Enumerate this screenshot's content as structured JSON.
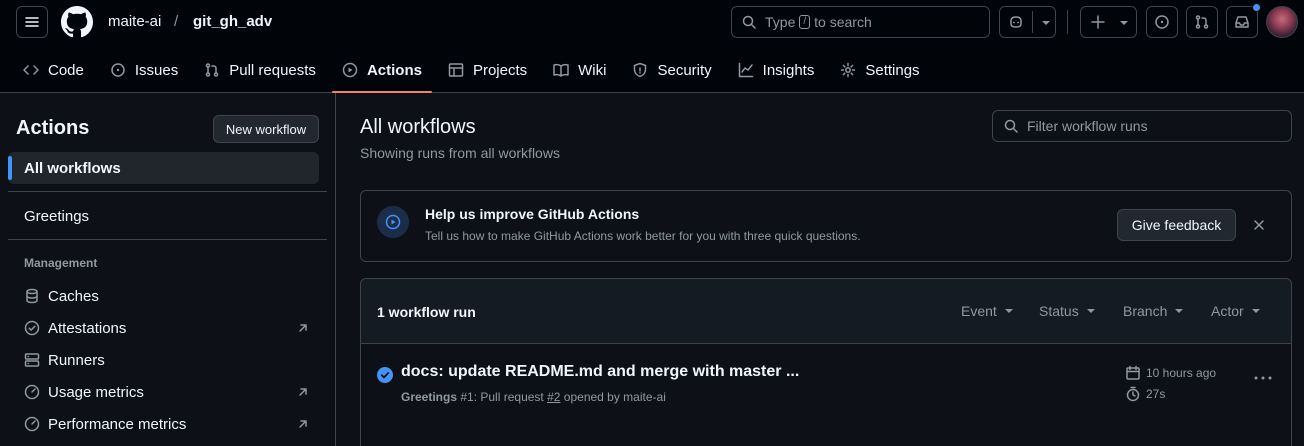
{
  "header": {
    "owner": "maite-ai",
    "separator": "/",
    "repo": "git_gh_adv",
    "search": {
      "prefix": "Type",
      "key": "/",
      "suffix": "to search"
    }
  },
  "tabs": [
    {
      "label": "Code",
      "icon": "code-icon"
    },
    {
      "label": "Issues",
      "icon": "issue-icon"
    },
    {
      "label": "Pull requests",
      "icon": "pull-request-icon"
    },
    {
      "label": "Actions",
      "icon": "play-icon",
      "selected": true
    },
    {
      "label": "Projects",
      "icon": "table-icon"
    },
    {
      "label": "Wiki",
      "icon": "book-icon"
    },
    {
      "label": "Security",
      "icon": "shield-icon"
    },
    {
      "label": "Insights",
      "icon": "graph-icon"
    },
    {
      "label": "Settings",
      "icon": "gear-icon"
    }
  ],
  "sidebar": {
    "title": "Actions",
    "new_workflow": "New workflow",
    "all_workflows": "All workflows",
    "greetings": "Greetings",
    "management_label": "Management",
    "management": [
      {
        "label": "Caches",
        "icon": "database-icon"
      },
      {
        "label": "Attestations",
        "icon": "verified-icon",
        "external": true
      },
      {
        "label": "Runners",
        "icon": "server-icon"
      },
      {
        "label": "Usage metrics",
        "icon": "meter-icon",
        "external": true
      },
      {
        "label": "Performance metrics",
        "icon": "meter-icon",
        "external": true
      }
    ]
  },
  "main": {
    "title": "All workflows",
    "subtitle": "Showing runs from all workflows",
    "filter_placeholder": "Filter workflow runs",
    "banner": {
      "title": "Help us improve GitHub Actions",
      "text": "Tell us how to make GitHub Actions work better for you with three quick questions.",
      "button": "Give feedback"
    },
    "runs": {
      "count_label": "1 workflow run",
      "filters": [
        "Event",
        "Status",
        "Branch",
        "Actor"
      ],
      "items": [
        {
          "title": "docs: update README.md and merge with master ...",
          "workflow": "Greetings",
          "run_text": "#1: Pull request",
          "pr": "#2",
          "by": "opened by maite-ai",
          "time": "10 hours ago",
          "duration": "27s",
          "status": "success"
        }
      ]
    }
  },
  "colors": {
    "accent": "#4493f8",
    "tab_underline": "#f78166",
    "success": "#4493f8",
    "notification": "#4493f8"
  }
}
